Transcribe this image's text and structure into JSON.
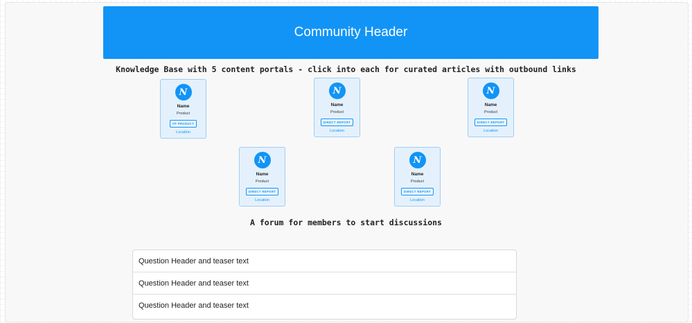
{
  "header": {
    "title": "Community Header"
  },
  "knowledge_base": {
    "intro": "Knowledge Base with 5 content portals - click into each for curated articles with outbound links",
    "cards": [
      {
        "avatar_glyph": "N",
        "name": "Name",
        "product": "Product",
        "badge": "VP PRODUCT",
        "location": "Location"
      },
      {
        "avatar_glyph": "N",
        "name": "Name",
        "product": "Product",
        "badge": "DIRECT REPORT",
        "location": "Location"
      },
      {
        "avatar_glyph": "N",
        "name": "Name",
        "product": "Product",
        "badge": "DIRECT REPORT",
        "location": "Location"
      },
      {
        "avatar_glyph": "N",
        "name": "Name",
        "product": "Product",
        "badge": "DIRECT REPORT",
        "location": "Location"
      },
      {
        "avatar_glyph": "N",
        "name": "Name",
        "product": "Product",
        "badge": "DIRECT REPORT",
        "location": "Location"
      }
    ]
  },
  "forum": {
    "intro": "A forum for members to start discussions",
    "questions": [
      {
        "text": "Question Header and teaser text"
      },
      {
        "text": "Question Header and teaser text"
      },
      {
        "text": "Question Header and teaser text"
      }
    ]
  },
  "colors": {
    "accent": "#1194f6",
    "card_bg": "#e4f1fc",
    "card_border": "#9fcdf3"
  }
}
